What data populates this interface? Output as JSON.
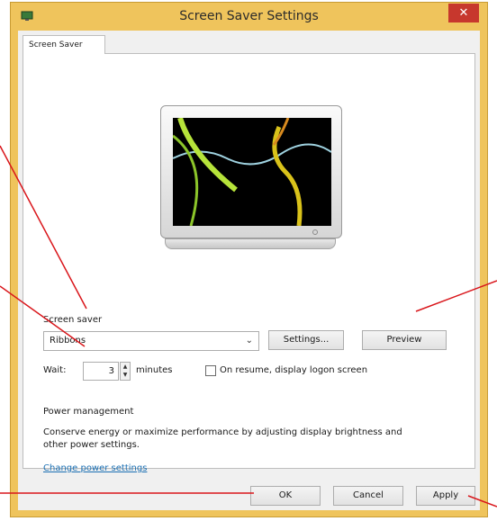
{
  "window": {
    "title": "Screen Saver Settings",
    "close_label": "✕"
  },
  "tabs": [
    {
      "label": "Screen Saver"
    }
  ],
  "screen_saver": {
    "group_label": "Screen saver",
    "selected": "Ribbons",
    "settings_label": "Settings...",
    "preview_label": "Preview",
    "wait_label": "Wait:",
    "wait_value": "3",
    "minutes_label": "minutes",
    "on_resume_label": "On resume, display logon screen",
    "on_resume_checked": false
  },
  "power": {
    "heading": "Power management",
    "description": "Conserve energy or maximize performance by adjusting display brightness and other power settings.",
    "link_label": "Change power settings"
  },
  "footer": {
    "ok_label": "OK",
    "cancel_label": "Cancel",
    "apply_label": "Apply"
  },
  "colors": {
    "frame": "#efc45c",
    "close": "#c7372d",
    "annotation": "#d9161b",
    "link": "#1a6fb3"
  }
}
